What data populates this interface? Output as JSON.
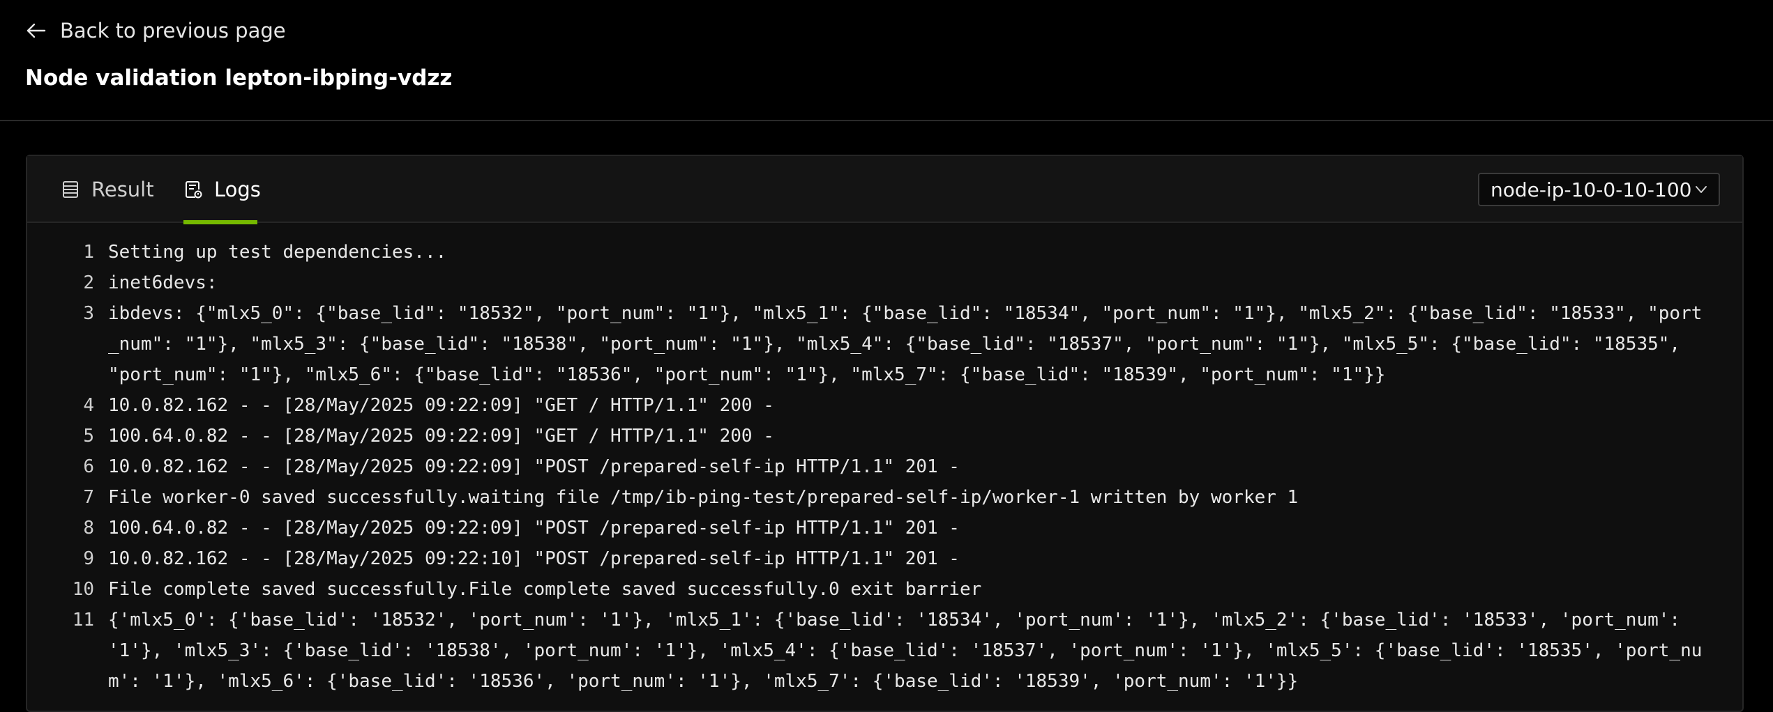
{
  "nav": {
    "back_label": "Back to previous page"
  },
  "page": {
    "title": "Node validation lepton-ibping-vdzz"
  },
  "tabs": [
    {
      "label": "Result",
      "icon": "list-icon",
      "active": false
    },
    {
      "label": "Logs",
      "icon": "log-file-icon",
      "active": true
    }
  ],
  "node_select": {
    "value": "node-ip-10-0-10-100"
  },
  "colors": {
    "accent": "#76b900",
    "background": "#000000",
    "panel": "#0f0f0f"
  },
  "logs": [
    {
      "num": "1",
      "text": "Setting up test dependencies..."
    },
    {
      "num": "2",
      "text": "inet6devs:"
    },
    {
      "num": "3",
      "text": "ibdevs: {\"mlx5_0\": {\"base_lid\": \"18532\", \"port_num\": \"1\"}, \"mlx5_1\": {\"base_lid\": \"18534\", \"port_num\": \"1\"}, \"mlx5_2\": {\"base_lid\": \"18533\", \"port_num\": \"1\"}, \"mlx5_3\": {\"base_lid\": \"18538\", \"port_num\": \"1\"}, \"mlx5_4\": {\"base_lid\": \"18537\", \"port_num\": \"1\"}, \"mlx5_5\": {\"base_lid\": \"18535\", \"port_num\": \"1\"}, \"mlx5_6\": {\"base_lid\": \"18536\", \"port_num\": \"1\"}, \"mlx5_7\": {\"base_lid\": \"18539\", \"port_num\": \"1\"}}"
    },
    {
      "num": "4",
      "text": "10.0.82.162 - - [28/May/2025 09:22:09] \"GET / HTTP/1.1\" 200 -"
    },
    {
      "num": "5",
      "text": "100.64.0.82 - - [28/May/2025 09:22:09] \"GET / HTTP/1.1\" 200 -"
    },
    {
      "num": "6",
      "text": "10.0.82.162 - - [28/May/2025 09:22:09] \"POST /prepared-self-ip HTTP/1.1\" 201 -"
    },
    {
      "num": "7",
      "text": "File worker-0 saved successfully.waiting file /tmp/ib-ping-test/prepared-self-ip/worker-1 written by worker 1"
    },
    {
      "num": "8",
      "text": "100.64.0.82 - - [28/May/2025 09:22:09] \"POST /prepared-self-ip HTTP/1.1\" 201 -"
    },
    {
      "num": "9",
      "text": "10.0.82.162 - - [28/May/2025 09:22:10] \"POST /prepared-self-ip HTTP/1.1\" 201 -"
    },
    {
      "num": "10",
      "text": "File complete saved successfully.File complete saved successfully.0 exit barrier"
    },
    {
      "num": "11",
      "text": "{'mlx5_0': {'base_lid': '18532', 'port_num': '1'}, 'mlx5_1': {'base_lid': '18534', 'port_num': '1'}, 'mlx5_2': {'base_lid': '18533', 'port_num': '1'}, 'mlx5_3': {'base_lid': '18538', 'port_num': '1'}, 'mlx5_4': {'base_lid': '18537', 'port_num': '1'}, 'mlx5_5': {'base_lid': '18535', 'port_num': '1'}, 'mlx5_6': {'base_lid': '18536', 'port_num': '1'}, 'mlx5_7': {'base_lid': '18539', 'port_num': '1'}}"
    }
  ]
}
